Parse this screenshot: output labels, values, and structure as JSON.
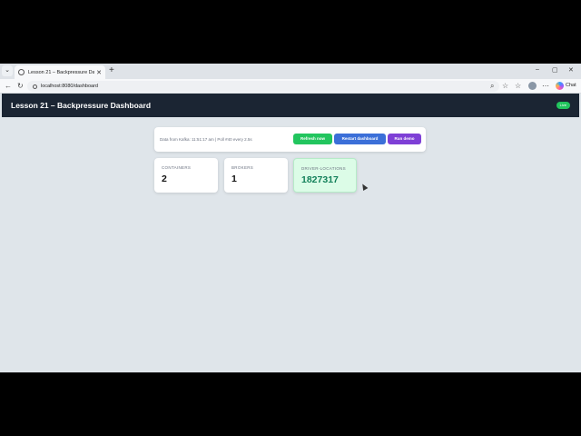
{
  "browser": {
    "tab_title": "Lesson 21 – Backpressure Dashbo",
    "tab_close": "✕",
    "new_tab": "+",
    "url": "localhost:8080/dashboard",
    "chat_label": "Chat",
    "window_controls": [
      "–",
      "▢",
      "✕"
    ]
  },
  "app": {
    "title": "Lesson 21 – Backpressure Dashboard",
    "live_badge": "Live"
  },
  "toolbar": {
    "status_text": "Data from Kafka: 11:51:17 am | Poll #40 every 2.5s",
    "buttons": [
      {
        "label": "Refresh now",
        "color": "#22c55e"
      },
      {
        "label": "Restart dashboard",
        "color": "#3b6fd8"
      },
      {
        "label": "Run demo",
        "color": "#7e3fd6"
      }
    ]
  },
  "metrics": [
    {
      "label": "CONTAINERS",
      "value": "2"
    },
    {
      "label": "BROKERS",
      "value": "1"
    },
    {
      "label": "DRIVER-LOCATIONS",
      "value": "1827317"
    }
  ],
  "colors": {
    "header_bg": "#1b2533",
    "accent_green": "#22c55e",
    "highlight_value": "#13805a"
  }
}
